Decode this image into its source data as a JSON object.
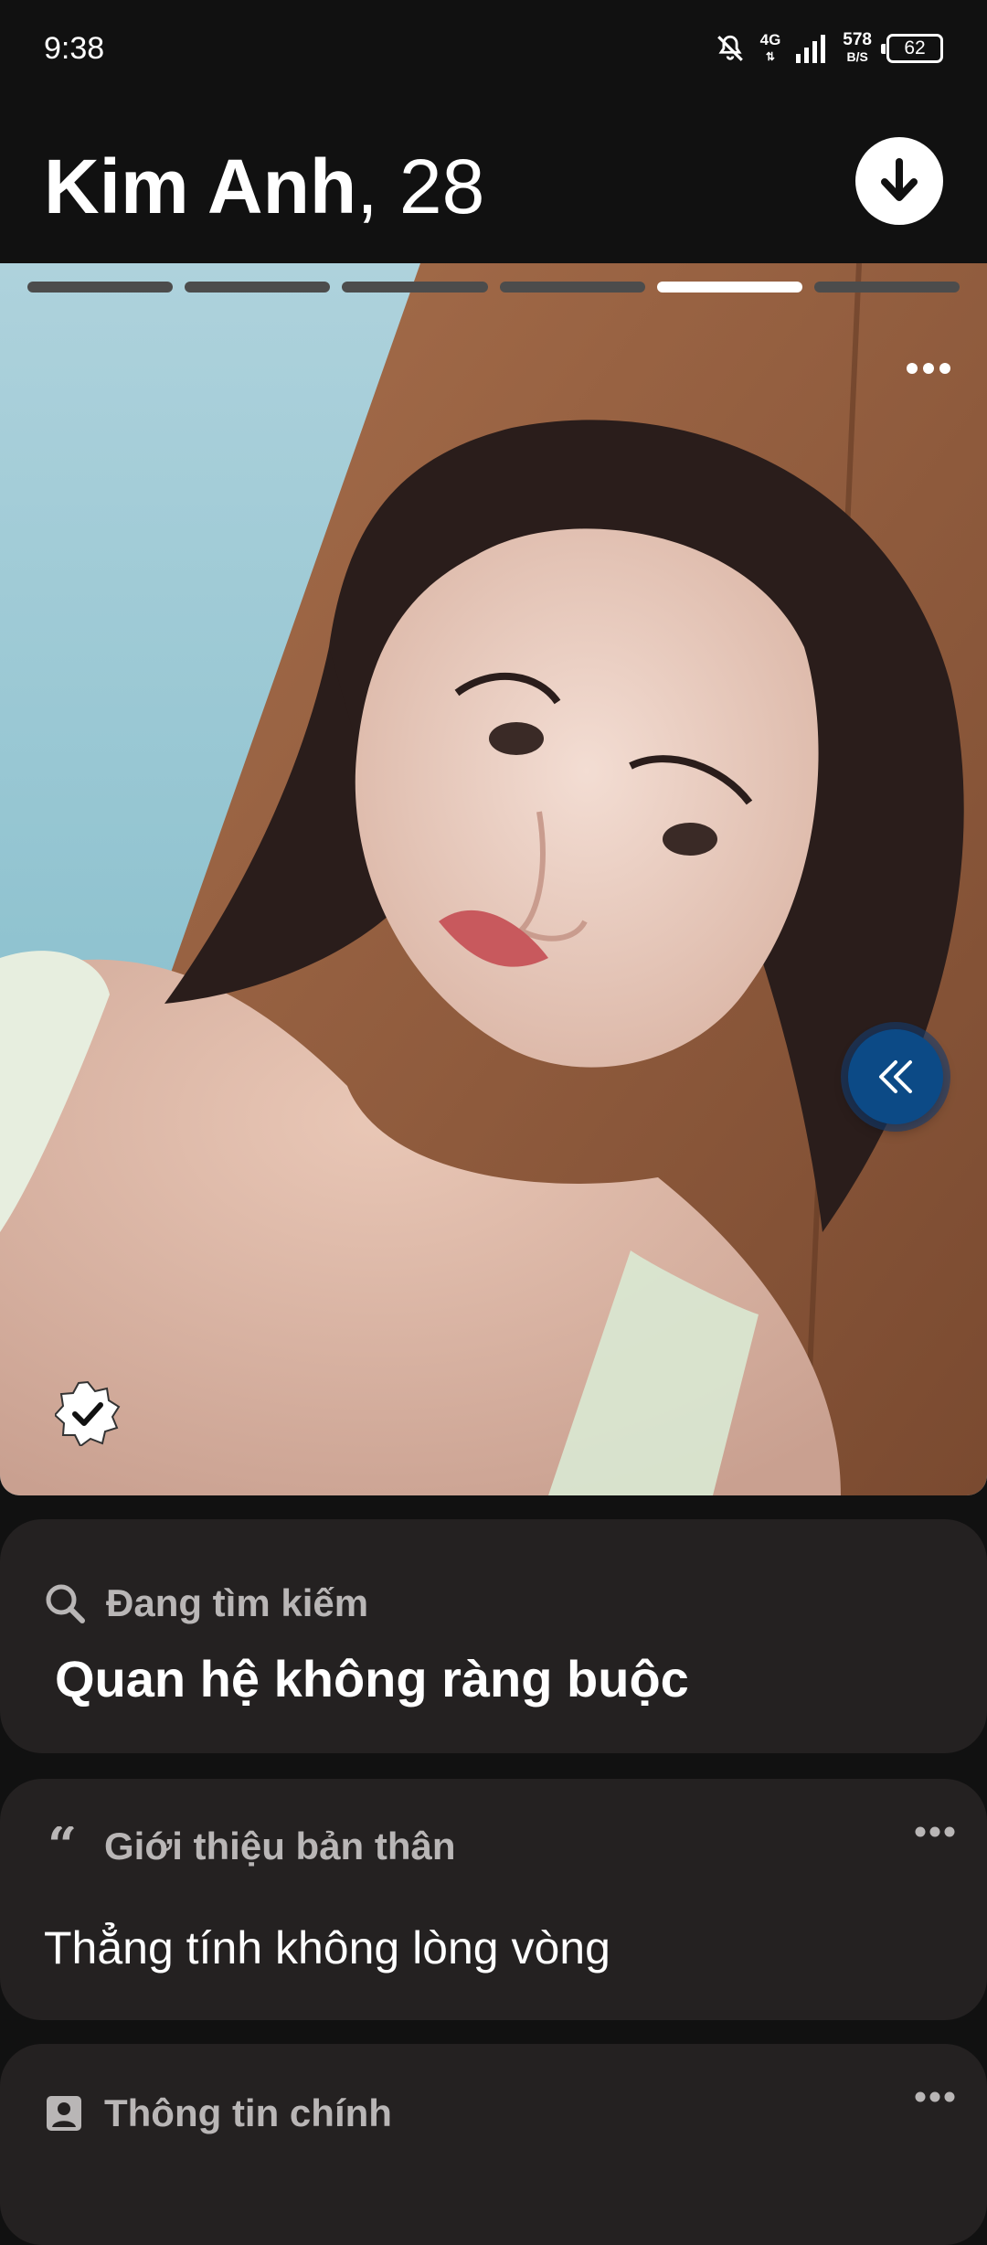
{
  "status_bar": {
    "time": "9:38",
    "network": "4G",
    "speed_value": "578",
    "speed_unit": "B/S",
    "battery": "62"
  },
  "header": {
    "name": "Kim Anh",
    "age": "28",
    "download_icon": "download-arrow-icon"
  },
  "photo": {
    "segments": [
      false,
      false,
      false,
      false,
      true,
      false
    ],
    "more_icon": "more-horizontal-icon",
    "rewind_icon": "double-chevron-left-icon",
    "verified_icon": "verified-badge-icon"
  },
  "looking_for": {
    "label": "Đang tìm kiếm",
    "value": "Quan hệ không ràng buộc",
    "icon": "search-icon"
  },
  "bio": {
    "label": "Giới thiệu bản thân",
    "value": "Thẳng tính không lòng vòng",
    "icon": "quote-icon"
  },
  "essentials": {
    "label": "Thông tin chính",
    "icon": "contact-card-icon"
  },
  "colors": {
    "background": "#111111",
    "card": "#242121",
    "rewind_button": "#0c4a86",
    "muted_label": "#b9b6b6"
  }
}
